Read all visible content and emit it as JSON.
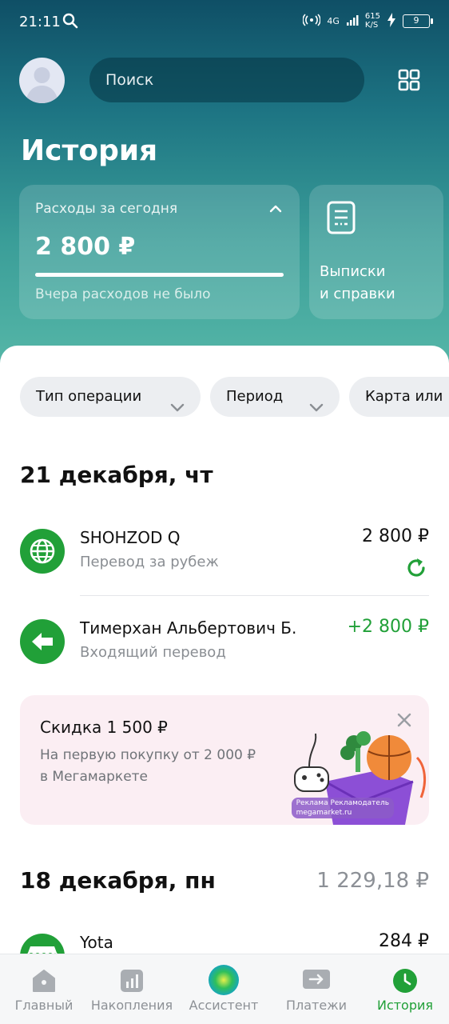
{
  "status_bar": {
    "time": "21:11",
    "network": "4G",
    "speed": "615",
    "speed_unit": "K/S",
    "battery": "9"
  },
  "header": {
    "search_placeholder": "Поиск"
  },
  "page": {
    "title": "История"
  },
  "expenses_card": {
    "label": "Расходы за сегодня",
    "amount": "2 800 ₽",
    "note": "Вчера расходов не было",
    "progress": 1.0
  },
  "statements_card": {
    "line1": "Выписки",
    "line2": "и справки"
  },
  "filters": [
    {
      "label": "Тип операции"
    },
    {
      "label": "Период"
    },
    {
      "label": "Карта или"
    }
  ],
  "groups": [
    {
      "date": "21 декабря, чт",
      "total": "",
      "transactions": [
        {
          "name": "SHOHZOD Q",
          "subtitle": "Перевод за рубеж",
          "amount": "2 800 ₽",
          "icon": "globe-icon"
        },
        {
          "name": "Тимерхан Альбертович Б.",
          "subtitle": "Входящий перевод",
          "amount": "+2 800 ₽",
          "icon": "arrow-left-icon"
        }
      ]
    },
    {
      "date": "18 декабря, пн",
      "total": "1 229,18 ₽",
      "transactions": [
        {
          "name": "Yota",
          "subtitle": "",
          "amount": "284 ₽",
          "icon": "store-icon"
        }
      ]
    }
  ],
  "promo": {
    "title": "Скидка 1 500 ₽",
    "line1": "На первую покупку от 2 000 ₽",
    "line2": "в Мегамаркете",
    "ad_label": "Реклама Рекламодатель",
    "ad_site": "megamarket.ru"
  },
  "tabs": [
    {
      "label": "Главный",
      "icon": "home-icon"
    },
    {
      "label": "Накопления",
      "icon": "chart-icon"
    },
    {
      "label": "Ассистент",
      "icon": "assistant-orb-icon"
    },
    {
      "label": "Платежи",
      "icon": "transfer-icon"
    },
    {
      "label": "История",
      "icon": "clock-icon",
      "active": true
    }
  ],
  "colors": {
    "accent": "#21a038",
    "hero_top": "#0f4f66",
    "hero_bottom": "#56b7a8",
    "muted": "#8a8e93"
  }
}
